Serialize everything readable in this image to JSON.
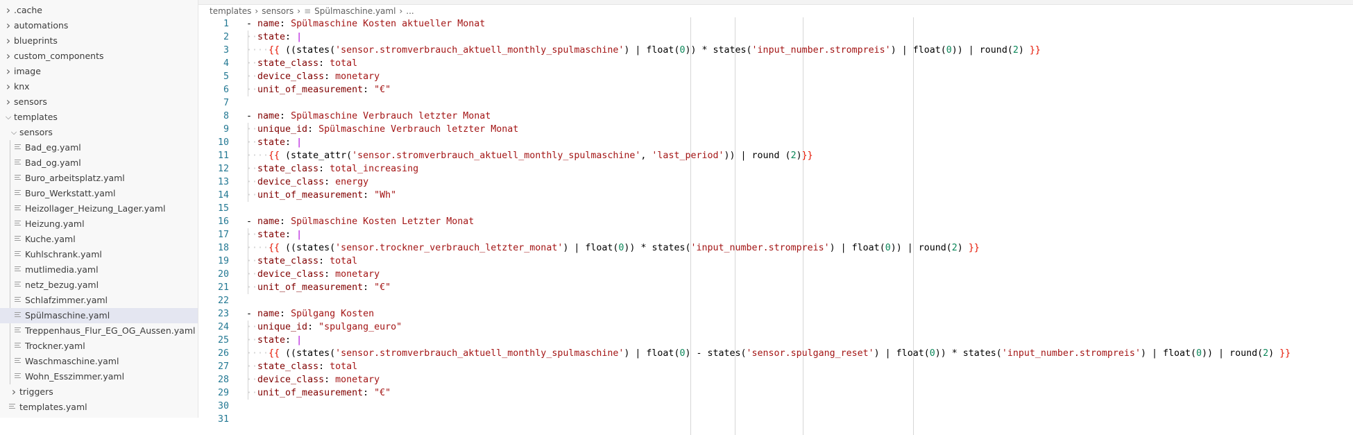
{
  "explorer": {
    "items": [
      {
        "label": ".cache",
        "type": "folder",
        "expanded": false,
        "depth": 0
      },
      {
        "label": "automations",
        "type": "folder",
        "expanded": false,
        "depth": 0
      },
      {
        "label": "blueprints",
        "type": "folder",
        "expanded": false,
        "depth": 0
      },
      {
        "label": "custom_components",
        "type": "folder",
        "expanded": false,
        "depth": 0
      },
      {
        "label": "image",
        "type": "folder",
        "expanded": false,
        "depth": 0
      },
      {
        "label": "knx",
        "type": "folder",
        "expanded": false,
        "depth": 0
      },
      {
        "label": "sensors",
        "type": "folder",
        "expanded": false,
        "depth": 0
      },
      {
        "label": "templates",
        "type": "folder",
        "expanded": true,
        "depth": 0
      },
      {
        "label": "sensors",
        "type": "folder",
        "expanded": true,
        "depth": 1
      },
      {
        "label": "Bad_eg.yaml",
        "type": "file",
        "depth": 2
      },
      {
        "label": "Bad_og.yaml",
        "type": "file",
        "depth": 2
      },
      {
        "label": "Buro_arbeitsplatz.yaml",
        "type": "file",
        "depth": 2
      },
      {
        "label": "Buro_Werkstatt.yaml",
        "type": "file",
        "depth": 2
      },
      {
        "label": "Heizollager_Heizung_Lager.yaml",
        "type": "file",
        "depth": 2
      },
      {
        "label": "Heizung.yaml",
        "type": "file",
        "depth": 2
      },
      {
        "label": "Kuche.yaml",
        "type": "file",
        "depth": 2
      },
      {
        "label": "Kuhlschrank.yaml",
        "type": "file",
        "depth": 2
      },
      {
        "label": "mutlimedia.yaml",
        "type": "file",
        "depth": 2
      },
      {
        "label": "netz_bezug.yaml",
        "type": "file",
        "depth": 2
      },
      {
        "label": "Schlafzimmer.yaml",
        "type": "file",
        "depth": 2
      },
      {
        "label": "Spülmaschine.yaml",
        "type": "file",
        "depth": 2,
        "selected": true
      },
      {
        "label": "Treppenhaus_Flur_EG_OG_Aussen.yaml",
        "type": "file",
        "depth": 2
      },
      {
        "label": "Trockner.yaml",
        "type": "file",
        "depth": 2
      },
      {
        "label": "Waschmaschine.yaml",
        "type": "file",
        "depth": 2
      },
      {
        "label": "Wohn_Esszimmer.yaml",
        "type": "file",
        "depth": 2
      },
      {
        "label": "triggers",
        "type": "folder",
        "expanded": false,
        "depth": 1
      },
      {
        "label": "templates.yaml",
        "type": "file",
        "depth": 1
      }
    ]
  },
  "breadcrumb": [
    "templates",
    "sensors",
    "Spülmaschine.yaml",
    "..."
  ],
  "editor": {
    "lines": [
      "- name: Spülmaschine Kosten aktueller Monat",
      "  state: |",
      "    {{ ((states('sensor.stromverbrauch_aktuell_monthly_spulmaschine') | float(0)) * states('input_number.strompreis') | float(0)) | round(2) }}",
      "  state_class: total",
      "  device_class: monetary",
      "  unit_of_measurement: \"€\"",
      "",
      "- name: Spülmaschine Verbrauch letzter Monat",
      "  unique_id: Spülmaschine Verbrauch letzter Monat",
      "  state: |",
      "    {{ (state_attr('sensor.stromverbrauch_aktuell_monthly_spulmaschine', 'last_period')) | round (2)}}",
      "  state_class: total_increasing",
      "  device_class: energy",
      "  unit_of_measurement: \"Wh\"",
      "",
      "- name: Spülmaschine Kosten Letzter Monat",
      "  state: |",
      "    {{ ((states('sensor.trockner_verbrauch_letzter_monat') | float(0)) * states('input_number.strompreis') | float(0)) | round(2) }}",
      "  state_class: total",
      "  device_class: monetary",
      "  unit_of_measurement: \"€\"",
      "",
      "- name: Spülgang Kosten",
      "  unique_id: \"spulgang_euro\"",
      "  state: |",
      "    {{ ((states('sensor.stromverbrauch_aktuell_monthly_spulmaschine') | float(0) - states('sensor.spulgang_reset') | float(0)) * states('input_number.strompreis') | float(0)) | round(2) }}",
      "  state_class: total",
      "  device_class: monetary",
      "  unit_of_measurement: \"€\"",
      "",
      ""
    ]
  },
  "colors": {
    "key": "#800000",
    "value": "#a31515",
    "number": "#098658",
    "brace": "#e51400",
    "block_indicator": "#af00db",
    "line_number": "#237893",
    "selection": "#e4e6f1"
  }
}
